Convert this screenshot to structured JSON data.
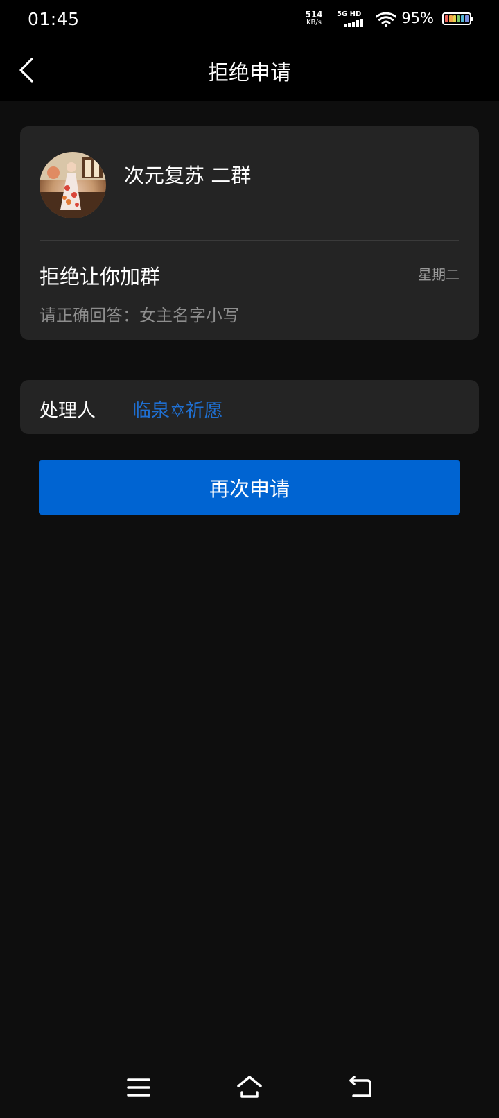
{
  "status_bar": {
    "time": "01:45",
    "net_speed_value": "514",
    "net_speed_unit": "KB/s",
    "signal_label": "5G HD",
    "battery_percent": "95%"
  },
  "nav": {
    "title": "拒绝申请",
    "back_icon": "chevron-left-icon"
  },
  "group_card": {
    "avatar": "group-avatar",
    "group_name": "次元复苏 二群",
    "reject_title": "拒绝让你加群",
    "reject_day": "星期二",
    "reject_reason": "请正确回答：女主名字小写"
  },
  "handler_card": {
    "label": "处理人",
    "name": "临泉✡祈愿",
    "name_color": "#1f6fd1"
  },
  "action": {
    "reapply_label": "再次申请",
    "button_color": "#0064d2"
  },
  "system_nav": {
    "menu_icon": "menu-icon",
    "home_icon": "home-icon",
    "back_icon": "return-icon"
  }
}
